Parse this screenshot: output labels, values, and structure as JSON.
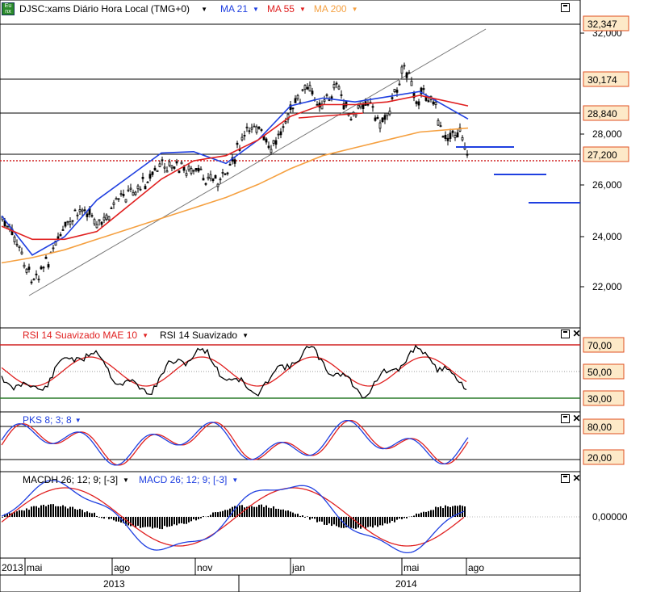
{
  "header": {
    "icon": "exchange-logo-icon",
    "symbol_label": "DJSC:xams Diário Hora Local (TMG+0)",
    "ma21_label": "MA 21",
    "ma55_label": "MA 55",
    "ma200_label": "MA 200"
  },
  "panels": {
    "rsi_label": "RSI 14 Suavizado MAE 10",
    "rsi2_label": "RSI 14 Suavizado",
    "pks_label": "PKS 8; 3; 8",
    "macdh_label": "MACDH 26; 12; 9; [-3]",
    "macd_label": "MACD 26; 12; 9; [-3]"
  },
  "colors": {
    "ma21": "#1f3fe0",
    "ma55": "#e02020",
    "ma200": "#f5a040",
    "tag_bg": "#fde9c8",
    "tag_border": "#e05020"
  },
  "chart_data": [
    {
      "type": "candlestick",
      "title": "DJSC:xams Diário Hora Local (TMG+0)",
      "y_ticks": [
        "32,000",
        "28,000",
        "26,000",
        "24,000",
        "22,000"
      ],
      "price_tags": [
        "32,347",
        "30,174",
        "28,840",
        "27,200"
      ],
      "ylim": [
        20500,
        32600
      ],
      "x_ticks": [
        "2013",
        "mai",
        "ago",
        "nov",
        "jan",
        "mai",
        "ago"
      ],
      "years": [
        "2013",
        "2014"
      ],
      "series": [
        {
          "name": "MA 21",
          "values": [
            24600,
            23100,
            23800,
            25200,
            26100,
            27000,
            27050,
            26600,
            27500,
            28800,
            29100,
            28950,
            29150,
            29350,
            28300
          ]
        },
        {
          "name": "MA 55",
          "values": [
            24200,
            23700,
            23700,
            24000,
            25000,
            26000,
            26700,
            26900,
            27500,
            28400,
            28850,
            28850,
            28950,
            29200,
            28800
          ]
        },
        {
          "name": "MA 200",
          "values": [
            22800,
            23000,
            23300,
            23700,
            24100,
            24500,
            24900,
            25300,
            25800,
            26400,
            26900,
            27200,
            27500,
            27800,
            27950
          ]
        }
      ],
      "last_close": 27200
    },
    {
      "type": "line",
      "title": "RSI 14 Suavizado MAE 10",
      "y_ticks": [
        "70,00",
        "50,00",
        "30,00"
      ],
      "ylim": [
        25,
        75
      ]
    },
    {
      "type": "line",
      "title": "PKS 8; 3; 8",
      "y_ticks": [
        "80,00",
        "20,00"
      ],
      "ylim": [
        0,
        100
      ]
    },
    {
      "type": "bar",
      "title": "MACDH 26; 12; 9; [-3]",
      "y_ticks": [
        "0,00000"
      ]
    }
  ]
}
